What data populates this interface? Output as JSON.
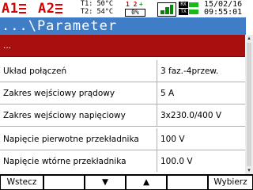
{
  "status": {
    "alarm1": "A1",
    "alarm2": "A2",
    "t1": "T1: 50°C",
    "t2": "T2: 54°C",
    "battery_12": "1 2",
    "battery_plus": "+",
    "battery_pct": "0%",
    "rx": "RX",
    "tx": "TX",
    "date": "15/02/16",
    "time": "09:55:01",
    "alarm_color": "#d50000",
    "signal_color": "#008a00"
  },
  "title": "...\\Parameter",
  "rows": [
    {
      "label": "...",
      "value": ""
    },
    {
      "label": "Układ połączeń",
      "value": "3 faz.-4przew."
    },
    {
      "label": "Zakres wejściowy prądowy",
      "value": "5 A"
    },
    {
      "label": "Zakres wejściowy napięciowy",
      "value": "3x230.0/400 V"
    },
    {
      "label": "Napięcie pierwotne przekładnika",
      "value": "100 V"
    },
    {
      "label": "Napięcie wtórne przekładnika",
      "value": "100.0 V"
    }
  ],
  "softkeys": {
    "back": "Wstecz",
    "down": "▼",
    "up": "▲",
    "select": "Wybierz"
  },
  "colors": {
    "title_bg": "#3f7ec6",
    "selected_row_bg": "#a80f0f"
  }
}
